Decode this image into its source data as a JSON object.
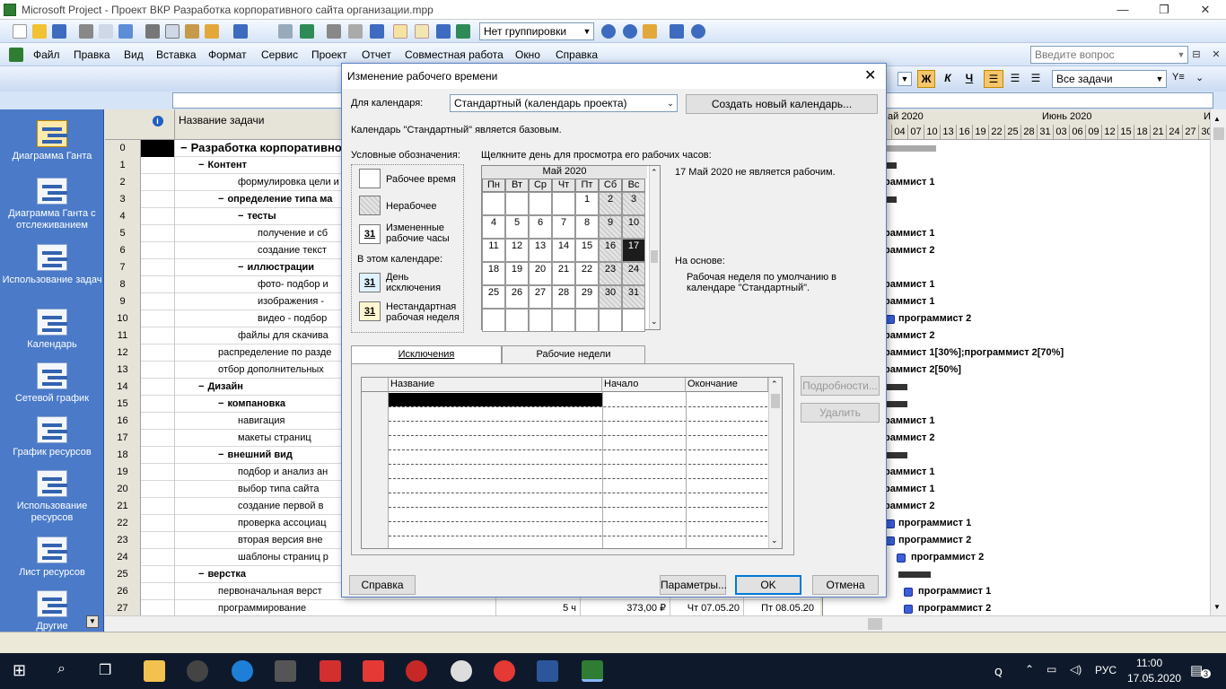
{
  "app": {
    "title": "Microsoft Project - Проект ВКР Разработка корпоративного сайта организации.mpp",
    "window_controls": [
      "—",
      "❐",
      "✕"
    ]
  },
  "toolbar1": {
    "grouping": "Нет группировки"
  },
  "menu": {
    "items": [
      "Файл",
      "Правка",
      "Вид",
      "Вставка",
      "Формат",
      "Сервис",
      "Проект",
      "Отчет",
      "Совместная работа",
      "Окно",
      "Справка"
    ],
    "question_placeholder": "Введите вопрос"
  },
  "toolbar2": {
    "bold": "Ж",
    "italic": "К",
    "underline": "Ч",
    "filter": "Все задачи"
  },
  "viewbar": {
    "items": [
      "Диаграмма Ганта",
      "Диаграмма Ганта с отслеживанием",
      "Использование задач",
      "Календарь",
      "Сетевой график",
      "График ресурсов",
      "Использование ресурсов",
      "Лист ресурсов",
      "Другие"
    ]
  },
  "table": {
    "header_name": "Название задачи",
    "rows": [
      {
        "id": "0",
        "name": "Разработка корпоративно",
        "level": 0,
        "summary": true
      },
      {
        "id": "1",
        "name": "Контент",
        "level": 1,
        "summary": true
      },
      {
        "id": "2",
        "name": "формулировка цели и п",
        "level": 3,
        "summary": false
      },
      {
        "id": "3",
        "name": "определение типа ма",
        "level": 2,
        "summary": true
      },
      {
        "id": "4",
        "name": "тесты",
        "level": 3,
        "summary": true
      },
      {
        "id": "5",
        "name": "получение и сб",
        "level": 4,
        "summary": false
      },
      {
        "id": "6",
        "name": "создание текст",
        "level": 4,
        "summary": false
      },
      {
        "id": "7",
        "name": "иллюстрации",
        "level": 3,
        "summary": true
      },
      {
        "id": "8",
        "name": "фото- подбор и",
        "level": 4,
        "summary": false
      },
      {
        "id": "9",
        "name": "изображения -",
        "level": 4,
        "summary": false
      },
      {
        "id": "10",
        "name": "видео - подбор",
        "level": 4,
        "summary": false
      },
      {
        "id": "11",
        "name": "файлы для скачива",
        "level": 3,
        "summary": false
      },
      {
        "id": "12",
        "name": "распределение по разде",
        "level": 2,
        "summary": false
      },
      {
        "id": "13",
        "name": "отбор дополнительных",
        "level": 2,
        "summary": false
      },
      {
        "id": "14",
        "name": "Дизайн",
        "level": 1,
        "summary": true
      },
      {
        "id": "15",
        "name": "компановка",
        "level": 2,
        "summary": true
      },
      {
        "id": "16",
        "name": "навигация",
        "level": 3,
        "summary": false
      },
      {
        "id": "17",
        "name": "макеты страниц",
        "level": 3,
        "summary": false
      },
      {
        "id": "18",
        "name": "внешний вид",
        "level": 2,
        "summary": true
      },
      {
        "id": "19",
        "name": "подбор и анализ ан",
        "level": 3,
        "summary": false
      },
      {
        "id": "20",
        "name": "выбор типа сайта",
        "level": 3,
        "summary": false
      },
      {
        "id": "21",
        "name": "создание первой в",
        "level": 3,
        "summary": false
      },
      {
        "id": "22",
        "name": "проверка ассоциац",
        "level": 3,
        "summary": false
      },
      {
        "id": "23",
        "name": "вторая версия вне",
        "level": 3,
        "summary": false
      },
      {
        "id": "24",
        "name": "шаблоны страниц р",
        "level": 3,
        "summary": false
      },
      {
        "id": "25",
        "name": "верстка",
        "level": 1,
        "summary": true
      },
      {
        "id": "26",
        "name": "первоначальная верст",
        "level": 2,
        "summary": false
      },
      {
        "id": "27",
        "name": "программирование",
        "level": 2,
        "summary": false,
        "duration": "5 ч",
        "cost": "373,00 ₽",
        "start": "Чт 07.05.20",
        "finish": "Пт 08.05.20"
      }
    ]
  },
  "gantt": {
    "month1": "ай 2020",
    "month2": "Июнь 2020",
    "month3": "И",
    "days": [
      "04",
      "07",
      "10",
      "13",
      "16",
      "19",
      "22",
      "25",
      "28",
      "31",
      "03",
      "06",
      "09",
      "12",
      "15",
      "18",
      "21",
      "24",
      "27",
      "30"
    ],
    "labels": [
      {
        "row": 2,
        "text": "раммист 1"
      },
      {
        "row": 5,
        "text": "раммист 1"
      },
      {
        "row": 6,
        "text": "раммист 2"
      },
      {
        "row": 8,
        "text": "раммист 1"
      },
      {
        "row": 9,
        "text": "раммист 1"
      },
      {
        "row": 10,
        "text": "программист 2"
      },
      {
        "row": 11,
        "text": "раммист 2"
      },
      {
        "row": 12,
        "text": "раммист 1[30%];программист 2[70%]"
      },
      {
        "row": 13,
        "text": "раммист 2[50%]"
      },
      {
        "row": 16,
        "text": "раммист 1"
      },
      {
        "row": 17,
        "text": "раммист 2"
      },
      {
        "row": 19,
        "text": "раммист 1"
      },
      {
        "row": 20,
        "text": "раммист 1"
      },
      {
        "row": 21,
        "text": "раммист 2"
      },
      {
        "row": 22,
        "text": "программист 1"
      },
      {
        "row": 23,
        "text": "программист 2"
      },
      {
        "row": 24,
        "text": "программист 2"
      },
      {
        "row": 26,
        "text": "программист 1"
      },
      {
        "row": 27,
        "text": "программист 2"
      }
    ]
  },
  "dialog": {
    "title": "Изменение рабочего времени",
    "for_calendar_label": "Для календаря:",
    "calendar_value": "Стандартный (календарь проекта)",
    "create_new_button": "Создать новый календарь...",
    "base_note": "Календарь \"Стандартный\" является базовым.",
    "legend_title": "Условные обозначения:",
    "legend": {
      "working": "Рабочее время",
      "nonworking": "Нерабочее",
      "changed_num": "31",
      "changed": "Измененные рабочие часы",
      "in_calendar": "В этом календаре:",
      "exception_num": "31",
      "exception": "День исключения",
      "nondefault_num": "31",
      "nondefault": "Нестандартная рабочая неделя"
    },
    "click_hint": "Щелкните день для просмотра его рабочих часов:",
    "month_title": "Май 2020",
    "weekdays": [
      "Пн",
      "Вт",
      "Ср",
      "Чт",
      "Пт",
      "Сб",
      "Вс"
    ],
    "weeks": [
      [
        "",
        "",
        "",
        "",
        "1",
        "2",
        "3"
      ],
      [
        "4",
        "5",
        "6",
        "7",
        "8",
        "9",
        "10"
      ],
      [
        "11",
        "12",
        "13",
        "14",
        "15",
        "16",
        "17"
      ],
      [
        "18",
        "19",
        "20",
        "21",
        "22",
        "23",
        "24"
      ],
      [
        "25",
        "26",
        "27",
        "28",
        "29",
        "30",
        "31"
      ],
      [
        "",
        "",
        "",
        "",
        "",
        "",
        ""
      ]
    ],
    "selected_day": "17",
    "day_status": "17 Май 2020 не является рабочим.",
    "based_on_label": "На основе:",
    "based_on_text": "Рабочая неделя по умолчанию в календаре \"Стандартный\".",
    "tabs": [
      "Исключения",
      "Рабочие недели"
    ],
    "exceptions_columns": [
      "Название",
      "Начало",
      "Окончание"
    ],
    "details_button": "Подробности...",
    "delete_button": "Удалить",
    "help_button": "Справка",
    "options_button": "Параметры...",
    "ok_button": "OK",
    "cancel_button": "Отмена"
  },
  "taskbar": {
    "lang": "РУС",
    "time": "11:00",
    "date": "17.05.2020",
    "notifications": "3"
  }
}
